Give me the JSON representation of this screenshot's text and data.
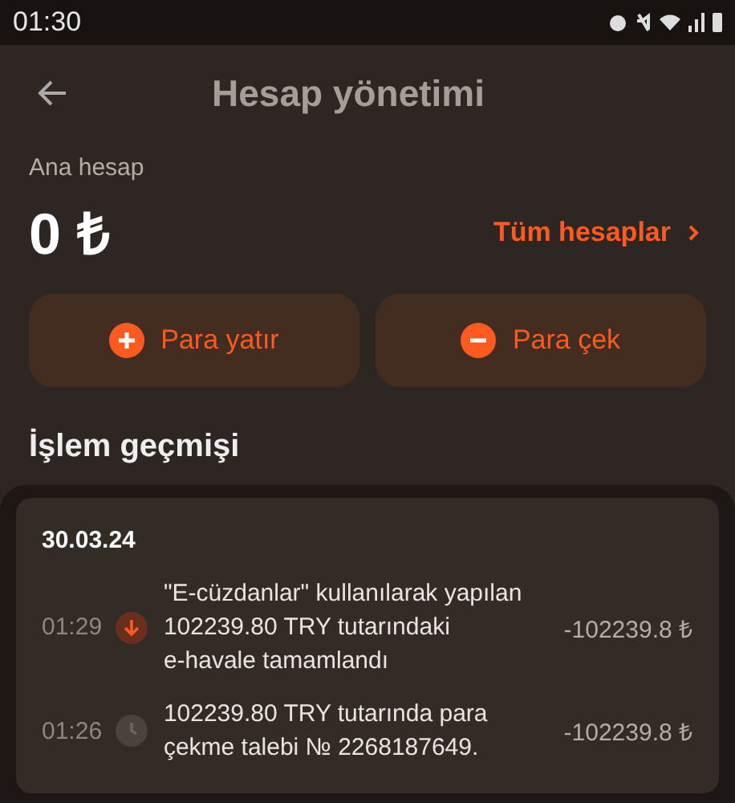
{
  "status_bar": {
    "time": "01:30"
  },
  "header": {
    "title": "Hesap yönetimi"
  },
  "account": {
    "label": "Ana hesap",
    "balance": "0 ₺",
    "all_accounts_link": "Tüm hesaplar"
  },
  "actions": [
    {
      "kind": "deposit",
      "label": "Para yatır"
    },
    {
      "kind": "withdraw",
      "label": "Para çek"
    }
  ],
  "history": {
    "title": "İşlem geçmişi",
    "groups": [
      {
        "date": "30.03.24",
        "items": [
          {
            "time": "01:29",
            "kind": "completed",
            "description": "\"E-cüzdanlar\" kullanılarak yapılan\n102239.80 TRY tutarındaki\ne-havale tamamlandı",
            "amount": "-102239.8 ₺"
          },
          {
            "time": "01:26",
            "kind": "pending",
            "description": "102239.80 TRY tutarında para\nçekme talebi № 2268187649.",
            "amount": "-102239.8 ₺"
          }
        ]
      }
    ]
  }
}
